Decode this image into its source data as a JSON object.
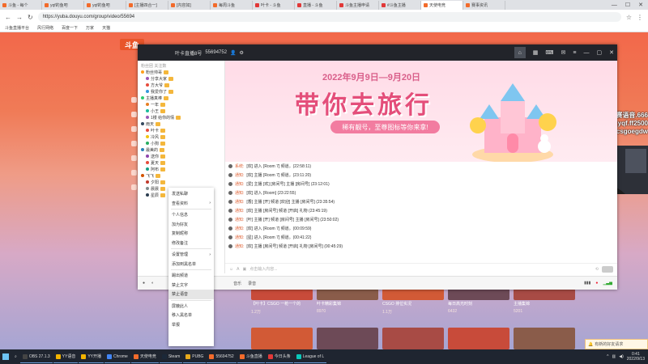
{
  "browser": {
    "tabs": [
      {
        "label": "斗鱼 - 每个",
        "color": "#f26b2b"
      },
      {
        "label": "yqf的鱼吧",
        "color": "#f26b2b"
      },
      {
        "label": "yqf的鱼吧",
        "color": "#f26b2b"
      },
      {
        "label": "[主播四合一]",
        "color": "#f26b2b"
      },
      {
        "label": "[内容如]",
        "color": "#f26b2b"
      },
      {
        "label": "每周斗鱼",
        "color": "#f26b2b"
      },
      {
        "label": "叶卡 - 斗鱼",
        "color": "#e13838"
      },
      {
        "label": "直播 - 斗鱼",
        "color": "#e13838"
      },
      {
        "label": "斗鱼主播申请",
        "color": "#e13838"
      },
      {
        "label": "#斗鱼主播",
        "color": "#e13838"
      },
      {
        "label": "天使电竞",
        "color": "#f26b2b"
      },
      {
        "label": "赛事资讯",
        "color": "#f26b2b"
      }
    ],
    "url": "https://yuba.douyu.com/group/video/55694",
    "bookmarks": [
      "斗鱼直播平台",
      "风行网络",
      "百度一下",
      "万家",
      "天猫"
    ]
  },
  "site": {
    "logo": "斗鱼"
  },
  "overlay": {
    "line1": "开黑就去比赛语音.666",
    "line2": "录制:yqf.ff2500",
    "line3": "csgo饰品:csgoegdw"
  },
  "app": {
    "topbar": {
      "room_name": "叶卡直播8号",
      "room_id": "55694752"
    },
    "left_panel": {
      "header": "粉丝团 关注数",
      "fans": [
        {
          "name": "粉丝帅哥",
          "color": "#ff9f1c"
        },
        {
          "name": "分享大家",
          "color": "#9b59b6"
        },
        {
          "name": "方大爷",
          "color": "#e74c3c"
        },
        {
          "name": "我爱你了",
          "color": "#3498db"
        },
        {
          "name": "主播真棒",
          "color": "#2ecc71"
        },
        {
          "name": "一年",
          "color": "#e67e22"
        },
        {
          "name": "小王",
          "color": "#1abc9c"
        },
        {
          "name": "1楼 给你的情",
          "color": "#9b59b6"
        },
        {
          "name": "雨天",
          "color": "#34495e"
        },
        {
          "name": "叶卡",
          "color": "#e74c3c"
        },
        {
          "name": "冷风",
          "color": "#f1c40f"
        },
        {
          "name": "小狗",
          "color": "#27ae60"
        },
        {
          "name": "最美的",
          "color": "#2980b9"
        },
        {
          "name": "送你",
          "color": "#8e44ad"
        },
        {
          "name": "夏天",
          "color": "#e74c3c"
        },
        {
          "name": "阿布",
          "color": "#16a085"
        },
        {
          "name": "飞飞",
          "color": "#d35400"
        },
        {
          "name": "夕阳",
          "color": "#c0392b"
        },
        {
          "name": "晨晨",
          "color": "#7f8c8d"
        },
        {
          "name": "星辰",
          "color": "#2c3e50"
        }
      ]
    },
    "banner": {
      "date": "2022年9月9日—9月20日",
      "title": "带你去旅行",
      "subtitle": "稀有靓号，至尊图标等你来拿!"
    },
    "chat": [
      {
        "tag": "系统:",
        "text": "[欢] 进入 [Room 7] 频道。(22:58:11)"
      },
      {
        "tag": "通知:",
        "text": "[欢] 主播 [Room 7] 频道。(23:11:20)"
      },
      {
        "tag": "通知:",
        "text": "[爱] 主播 [欢] [房间号] 主播 [房间号] (23:12:01)"
      },
      {
        "tag": "通知:",
        "text": "[欢] 进入 [Room] (23:22:55)"
      },
      {
        "tag": "通知:",
        "text": "[香] 主播 [开] 频道 [欢迎] 主播 [房间号] (23:35:54)"
      },
      {
        "tag": "通知:",
        "text": "[欢] 主播 [房间号] 频道 [开启] 礼物 (23:45:19)"
      },
      {
        "tag": "通知:",
        "text": "[叶] 主播 [开] 频道 [房间号] 主播 [房间号] (23:50:02)"
      },
      {
        "tag": "通知:",
        "text": "[欢] 进入 [Room 7] 频道。(00:09:59)"
      },
      {
        "tag": "通知:",
        "text": "[星] 进入 [Room 7] 频道。(00:41:22)"
      },
      {
        "tag": "通知:",
        "text": "[欢] 主播 [房间号] 频道 [开启] 礼物 [房间号] (00:45:29)"
      }
    ],
    "input_placeholder": "点击输入内容...",
    "bottombar": {
      "left": "音乐",
      "mid": "录音"
    }
  },
  "context_menu": [
    {
      "label": "发送私聊",
      "sub": false
    },
    {
      "label": "查看资料",
      "sub": true
    },
    {
      "label": "个人信息",
      "sub": false
    },
    {
      "label": "加为好友",
      "sub": false
    },
    {
      "label": "复制昵称",
      "sub": false
    },
    {
      "label": "修改备注",
      "sub": false
    },
    {
      "label": "设置管理",
      "sub": true
    },
    {
      "label": "添加到黑名单",
      "sub": false
    },
    {
      "label": "踢出频道",
      "sub": false
    },
    {
      "label": "禁止文字",
      "sub": false
    },
    {
      "label": "禁止语音",
      "sub": false
    },
    {
      "label": "屏蔽此人",
      "sub": false
    },
    {
      "label": "移入黑名单",
      "sub": false
    },
    {
      "label": "举报",
      "sub": false
    }
  ],
  "videos": [
    {
      "title": "【叶卡】CSGO 一枪一个的",
      "meta": "1.2万"
    },
    {
      "title": "叶卡精彩集锦",
      "meta": "8970"
    },
    {
      "title": "CSGO 排位实况",
      "meta": "1.1万"
    },
    {
      "title": "每日高光时刻",
      "meta": "6432"
    },
    {
      "title": "主播集锦",
      "meta": "5201"
    }
  ],
  "toast": "有新的好友请求",
  "taskbar": {
    "items": [
      {
        "label": "OBS 27.1.3",
        "color": "#444"
      },
      {
        "label": "YY语音",
        "color": "#f2b400"
      },
      {
        "label": "YY开播",
        "color": "#f2b400"
      },
      {
        "label": "Chrome",
        "color": "#4285f4"
      },
      {
        "label": "天使电竞",
        "color": "#f26b2b"
      },
      {
        "label": "Steam",
        "color": "#1b2838"
      },
      {
        "label": "PUBG",
        "color": "#e6a91c"
      },
      {
        "label": "55694752",
        "color": "#f26b2b"
      },
      {
        "label": "斗鱼直播",
        "color": "#f26b2b"
      },
      {
        "label": "今日头条",
        "color": "#e13838"
      },
      {
        "label": "League of L",
        "color": "#0ac8b9"
      }
    ],
    "time": "0:41",
    "date": "2022/9/13"
  }
}
